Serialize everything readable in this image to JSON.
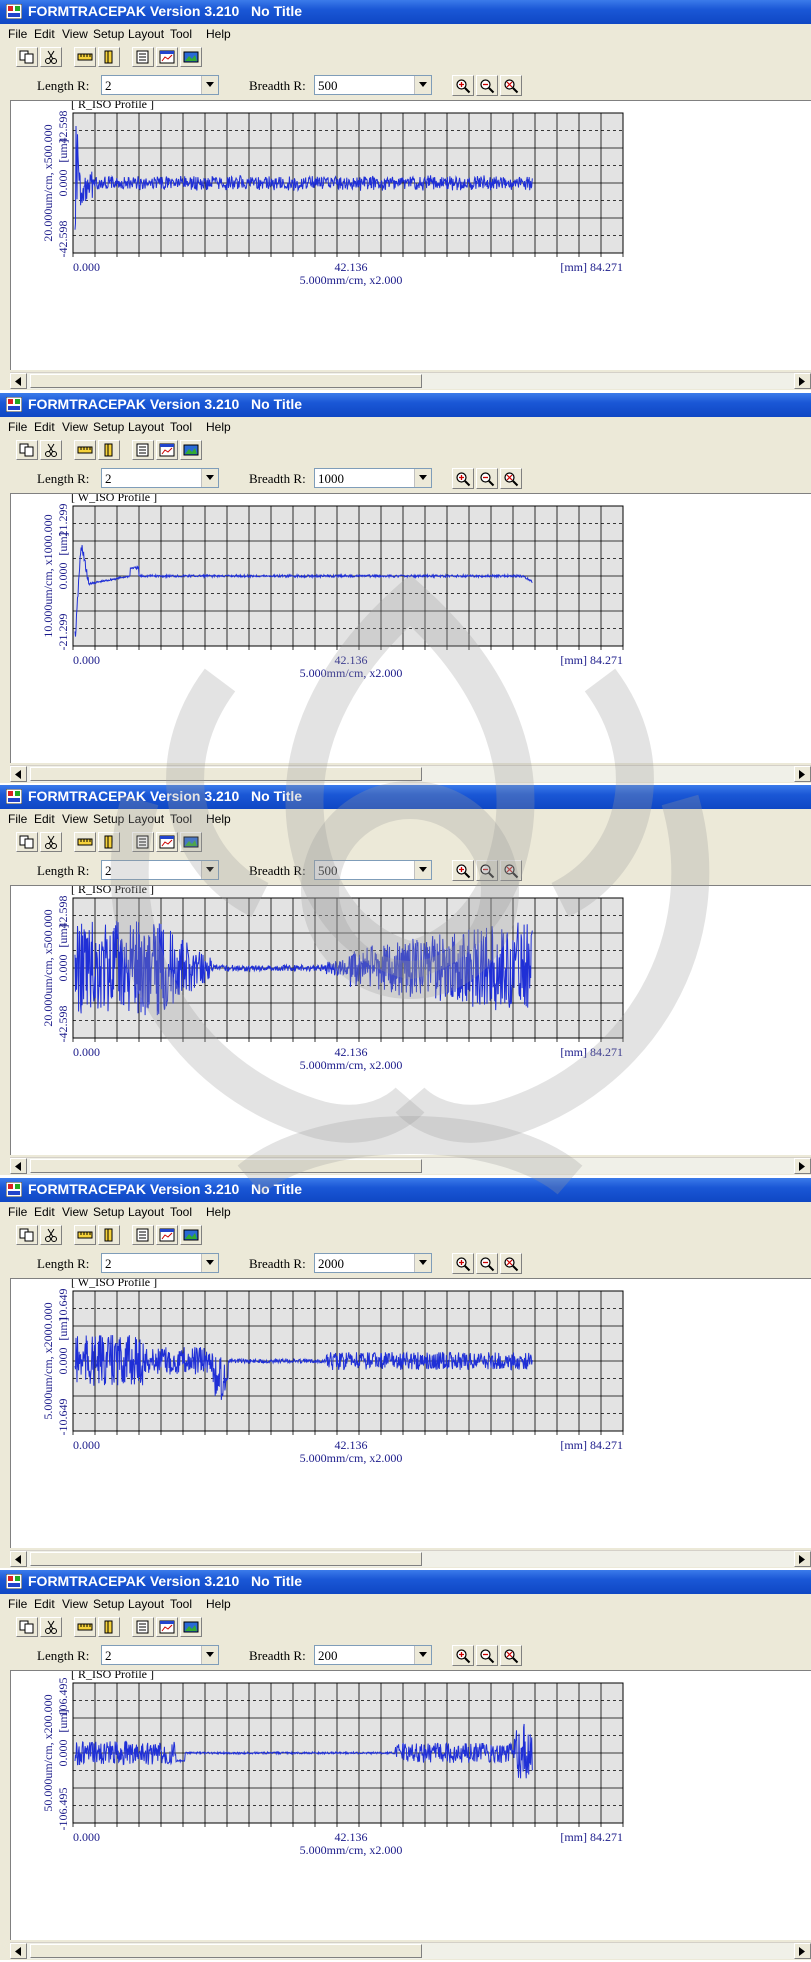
{
  "windows": [
    {
      "title": "FORMTRACEPAK Version 3.210   No Title",
      "menu": [
        "File",
        "Edit",
        "View",
        "Setup",
        "Layout",
        "Tool",
        "Help"
      ],
      "length_label": "Length R:",
      "length_value": "2",
      "breadth_label": "Breadth R:",
      "breadth_value": "500",
      "profile_label": "[ R_ISO Profile ]",
      "y_top": "42.598",
      "y_mid": "0.000",
      "y_bottom": "-42.598",
      "y_unit": "[um]",
      "y_scale": "20.000um/cm, x500.000",
      "x_left": "0.000",
      "x_mid": "42.136",
      "x_right": "[mm] 84.271",
      "x_scale": "5.000mm/cm, x2.000"
    },
    {
      "title": "FORMTRACEPAK Version 3.210   No Title",
      "menu": [
        "File",
        "Edit",
        "View",
        "Setup",
        "Layout",
        "Tool",
        "Help"
      ],
      "length_label": "Length R:",
      "length_value": "2",
      "breadth_label": "Breadth R:",
      "breadth_value": "1000",
      "profile_label": "[ W_ISO Profile ]",
      "y_top": "21.299",
      "y_mid": "0.000",
      "y_bottom": "-21.299",
      "y_unit": "[um]",
      "y_scale": "10.000um/cm, x1000.000",
      "x_left": "0.000",
      "x_mid": "42.136",
      "x_right": "[mm] 84.271",
      "x_scale": "5.000mm/cm, x2.000"
    },
    {
      "title": "FORMTRACEPAK Version 3.210   No Title",
      "menu": [
        "File",
        "Edit",
        "View",
        "Setup",
        "Layout",
        "Tool",
        "Help"
      ],
      "length_label": "Length R:",
      "length_value": "2",
      "breadth_label": "Breadth R:",
      "breadth_value": "500",
      "profile_label": "[ R_ISO Profile ]",
      "y_top": "42.598",
      "y_mid": "0.000",
      "y_bottom": "-42.598",
      "y_unit": "[um]",
      "y_scale": "20.000um/cm, x500.000",
      "x_left": "0.000",
      "x_mid": "42.136",
      "x_right": "[mm] 84.271",
      "x_scale": "5.000mm/cm, x2.000"
    },
    {
      "title": "FORMTRACEPAK Version 3.210   No Title",
      "menu": [
        "File",
        "Edit",
        "View",
        "Setup",
        "Layout",
        "Tool",
        "Help"
      ],
      "length_label": "Length R:",
      "length_value": "2",
      "breadth_label": "Breadth R:",
      "breadth_value": "2000",
      "profile_label": "[ W_ISO Profile ]",
      "y_top": "10.649",
      "y_mid": "0.000",
      "y_bottom": "-10.649",
      "y_unit": "[um]",
      "y_scale": "5.000um/cm, x2000.000",
      "x_left": "0.000",
      "x_mid": "42.136",
      "x_right": "[mm] 84.271",
      "x_scale": "5.000mm/cm, x2.000"
    },
    {
      "title": "FORMTRACEPAK Version 3.210   No Title",
      "menu": [
        "File",
        "Edit",
        "View",
        "Setup",
        "Layout",
        "Tool",
        "Help"
      ],
      "length_label": "Length R:",
      "length_value": "2",
      "breadth_label": "Breadth R:",
      "breadth_value": "200",
      "profile_label": "[ R_ISO Profile ]",
      "y_top": "106.495",
      "y_mid": "0.000",
      "y_bottom": "-106.495",
      "y_unit": "[um]",
      "y_scale": "50.000um/cm, x200.000",
      "x_left": "0.000",
      "x_mid": "42.136",
      "x_right": "[mm] 84.271",
      "x_scale": "5.000mm/cm, x2.000"
    }
  ],
  "colors": {
    "titlebar": "#0f47c4",
    "trace": "#1f2fd6",
    "plot_bg": "#e3e3e3",
    "grid": "#000000",
    "axis_text": "#1a1a8a"
  }
}
